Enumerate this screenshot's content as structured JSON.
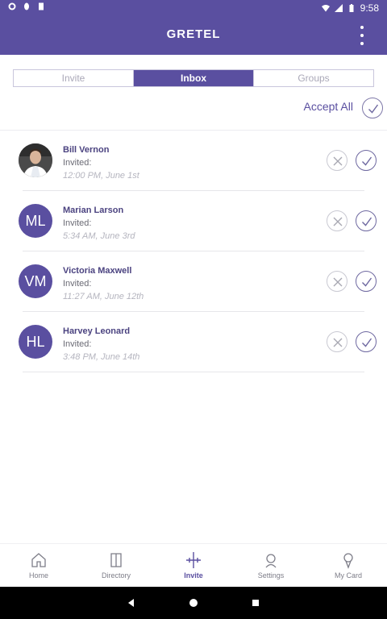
{
  "status_bar": {
    "time": "9:58"
  },
  "app_bar": {
    "logo": "GRETEL"
  },
  "tabs": [
    {
      "label": "Invite",
      "active": false
    },
    {
      "label": "Inbox",
      "active": true
    },
    {
      "label": "Groups",
      "active": false
    }
  ],
  "accept_all": {
    "label": "Accept All"
  },
  "invites": [
    {
      "name": "Bill Vernon",
      "initials": "",
      "status": "Invited:",
      "time": "12:00 PM, June 1st",
      "has_photo": true
    },
    {
      "name": "Marian Larson",
      "initials": "ML",
      "status": "Invited:",
      "time": "5:34 AM, June 3rd",
      "has_photo": false
    },
    {
      "name": "Victoria Maxwell",
      "initials": "VM",
      "status": "Invited:",
      "time": "11:27 AM, June 12th",
      "has_photo": false
    },
    {
      "name": "Harvey Leonard",
      "initials": "HL",
      "status": "Invited:",
      "time": "3:48 PM, June 14th",
      "has_photo": false
    }
  ],
  "bottom_nav": [
    {
      "label": "Home",
      "icon": "home-icon",
      "active": false
    },
    {
      "label": "Directory",
      "icon": "directory-icon",
      "active": false
    },
    {
      "label": "Invite",
      "icon": "invite-icon",
      "active": true
    },
    {
      "label": "Settings",
      "icon": "settings-icon",
      "active": false
    },
    {
      "label": "My Card",
      "icon": "my-card-icon",
      "active": false
    }
  ],
  "colors": {
    "brand": "#5a4fa0",
    "muted": "#b5b5bf"
  }
}
